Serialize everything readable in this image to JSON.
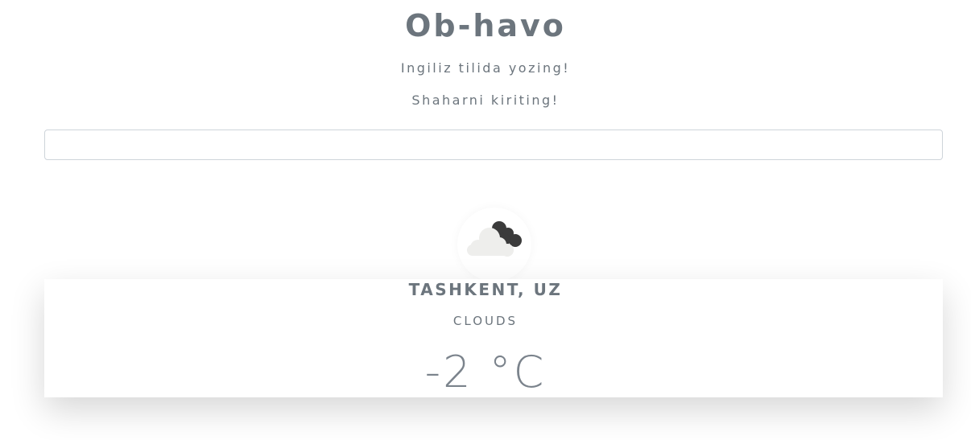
{
  "header": {
    "title": "Ob-havo",
    "hint_language": "Ingiliz tilida yozing!",
    "hint_city": "Shaharni kiriting!"
  },
  "search": {
    "value": "",
    "placeholder": ""
  },
  "weather": {
    "icon": "cloud-icon",
    "city": "TASHKENT, UZ",
    "condition": "CLOUDS",
    "temperature": "-2 °C"
  },
  "colors": {
    "text": "#6c757d",
    "cloud_light": "#eeeeec",
    "cloud_dark": "#3b3b3b",
    "input_border": "#ced4da"
  }
}
